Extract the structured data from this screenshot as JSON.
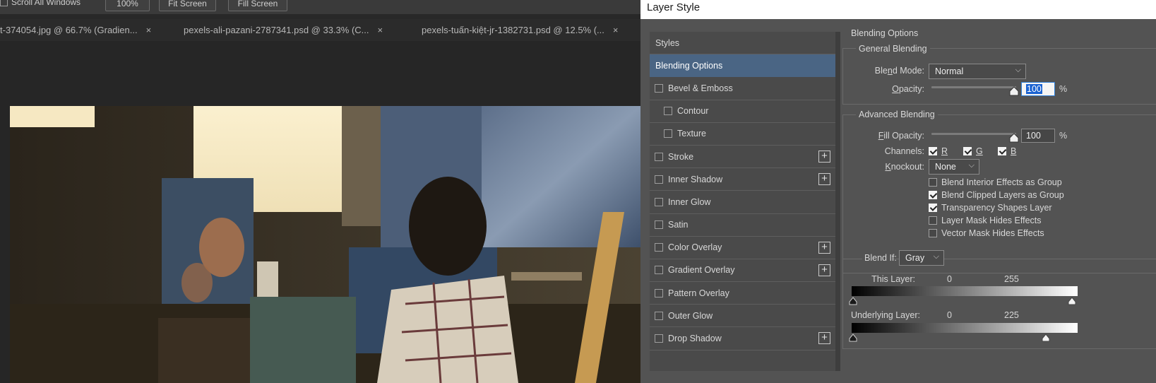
{
  "optionsbar": {
    "scroll_all_windows": "Scroll All Windows",
    "zoom_button": "100%",
    "fit_screen": "Fit Screen",
    "fill_screen": "Fill Screen"
  },
  "tabs": [
    {
      "label": "t-374054.jpg @ 66.7% (Gradien...",
      "close": "×"
    },
    {
      "label": "pexels-ali-pazani-2787341.psd @ 33.3% (C...",
      "close": "×"
    },
    {
      "label": "pexels-tuấn-kiệt-jr-1382731.psd @ 12.5% (...",
      "close": "×"
    }
  ],
  "dialog": {
    "title": "Layer Style",
    "styles_header": "Styles",
    "styles": [
      {
        "label": "Blending Options",
        "selected": true,
        "checkbox": false,
        "plus": false,
        "level": 0
      },
      {
        "label": "Bevel & Emboss",
        "checkbox": true,
        "plus": false,
        "level": 1
      },
      {
        "label": "Contour",
        "checkbox": true,
        "plus": false,
        "level": 2
      },
      {
        "label": "Texture",
        "checkbox": true,
        "plus": false,
        "level": 2
      },
      {
        "label": "Stroke",
        "checkbox": true,
        "plus": true,
        "level": 1
      },
      {
        "label": "Inner Shadow",
        "checkbox": true,
        "plus": true,
        "level": 1
      },
      {
        "label": "Inner Glow",
        "checkbox": true,
        "plus": false,
        "level": 1
      },
      {
        "label": "Satin",
        "checkbox": true,
        "plus": false,
        "level": 1
      },
      {
        "label": "Color Overlay",
        "checkbox": true,
        "plus": true,
        "level": 1
      },
      {
        "label": "Gradient Overlay",
        "checkbox": true,
        "plus": true,
        "level": 1
      },
      {
        "label": "Pattern Overlay",
        "checkbox": true,
        "plus": false,
        "level": 1
      },
      {
        "label": "Outer Glow",
        "checkbox": true,
        "plus": false,
        "level": 1
      },
      {
        "label": "Drop Shadow",
        "checkbox": true,
        "plus": true,
        "level": 1
      }
    ],
    "blending_options_title": "Blending Options",
    "general": {
      "title": "General Blending",
      "blend_mode_label": "Blend Mode:",
      "blend_mode_value": "Normal",
      "opacity_label": "Opacity:",
      "opacity_value": "100",
      "opacity_level": 100,
      "pct": "%"
    },
    "advanced": {
      "title": "Advanced Blending",
      "fill_opacity_label": "Fill Opacity:",
      "fill_opacity_value": "100",
      "fill_opacity_level": 100,
      "pct": "%",
      "channels_label": "Channels:",
      "channels": [
        {
          "label": "R",
          "checked": true
        },
        {
          "label": "G",
          "checked": true
        },
        {
          "label": "B",
          "checked": true
        }
      ],
      "knockout_label": "Knockout:",
      "knockout_value": "None",
      "options": [
        {
          "label": "Blend Interior Effects as Group",
          "checked": false
        },
        {
          "label": "Blend Clipped Layers as Group",
          "checked": true
        },
        {
          "label": "Transparency Shapes Layer",
          "checked": true
        },
        {
          "label": "Layer Mask Hides Effects",
          "checked": false
        },
        {
          "label": "Vector Mask Hides Effects",
          "checked": false
        }
      ]
    },
    "blend_if": {
      "label": "Blend If:",
      "value": "Gray",
      "this_layer_label": "This Layer:",
      "this_layer_low": "0",
      "this_layer_high": "255",
      "underlying_label": "Underlying Layer:",
      "underlying_low": "0",
      "underlying_high": "225"
    }
  }
}
